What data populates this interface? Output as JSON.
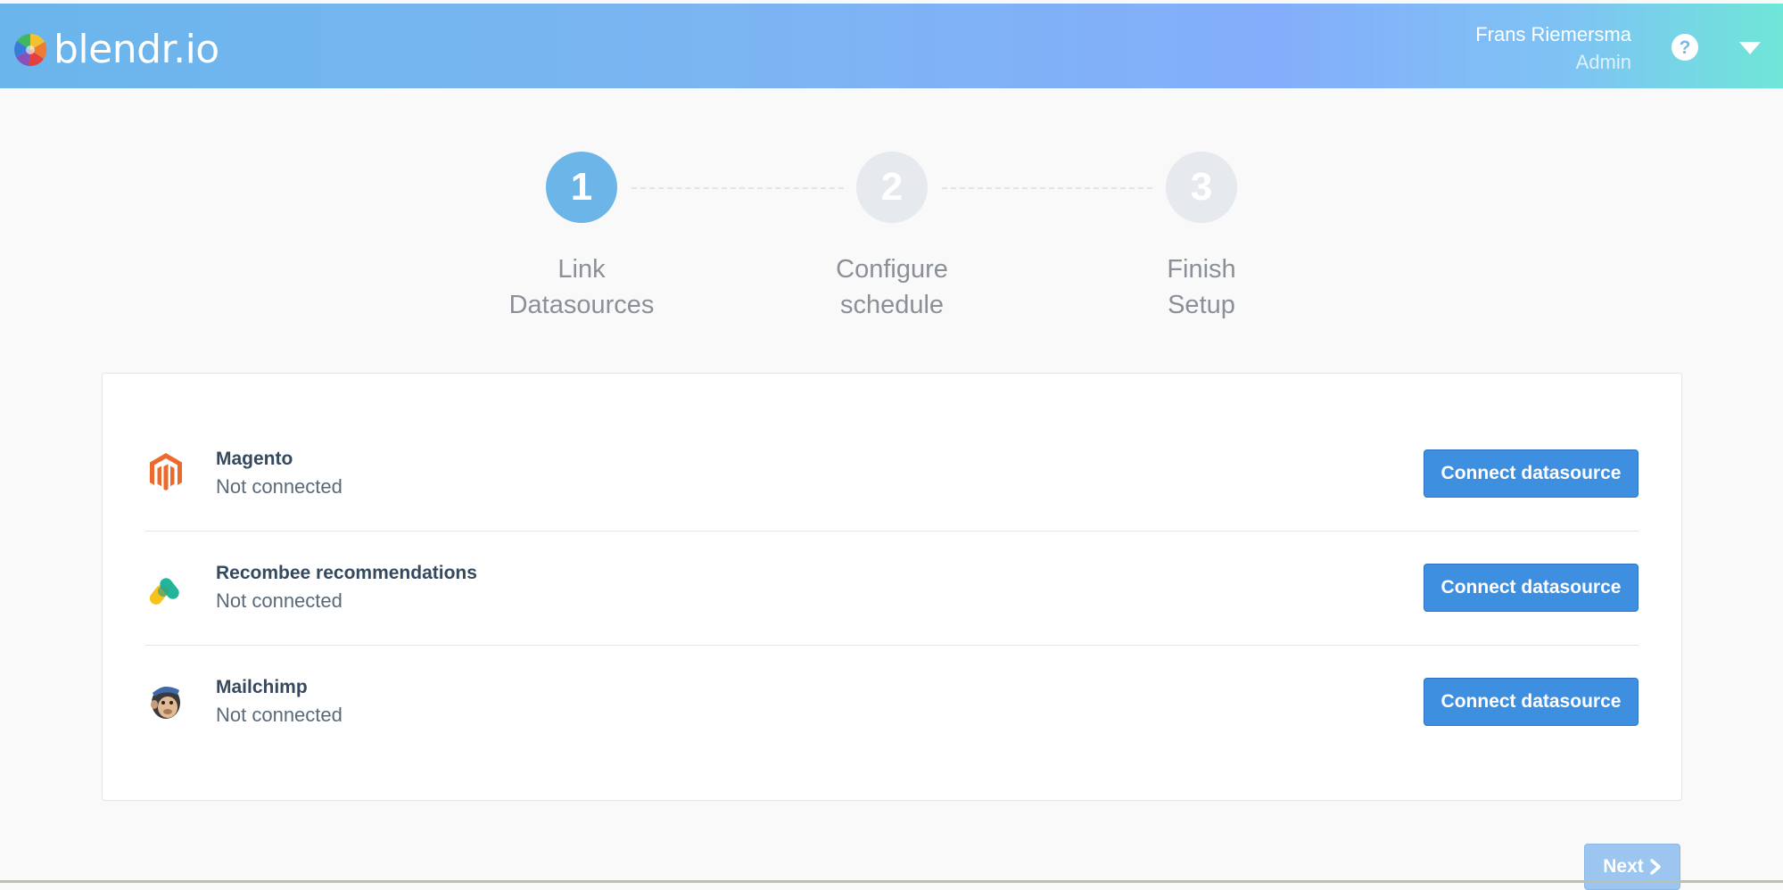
{
  "app": {
    "logo_text": "blendr.io"
  },
  "header": {
    "user_name": "Frans Riemersma",
    "user_role": "Admin",
    "icons": [
      "help-icon",
      "chevron-down-icon"
    ]
  },
  "stepper": {
    "active_index": 0,
    "steps": [
      {
        "number": "1",
        "line1": "Link",
        "line2": "Datasources",
        "state": "active"
      },
      {
        "number": "2",
        "line1": "Configure",
        "line2": "schedule",
        "state": "inactive"
      },
      {
        "number": "3",
        "line1": "Finish",
        "line2": "Setup",
        "state": "inactive"
      }
    ]
  },
  "datasources": [
    {
      "name": "Magento",
      "status": "Not connected",
      "icon": "magento-icon",
      "button_label": "Connect datasource"
    },
    {
      "name": "Recombee recommendations",
      "status": "Not connected",
      "icon": "recombee-icon",
      "button_label": "Connect datasource"
    },
    {
      "name": "Mailchimp",
      "status": "Not connected",
      "icon": "mailchimp-icon",
      "button_label": "Connect datasource"
    }
  ],
  "footer": {
    "next_label": "Next",
    "next_icon": "chevron-right-icon"
  },
  "colors": {
    "accent": "#3f8fe0",
    "step_active": "#6cb5e8",
    "step_inactive": "#e6e9ed",
    "magento": "#ec6a2c"
  }
}
